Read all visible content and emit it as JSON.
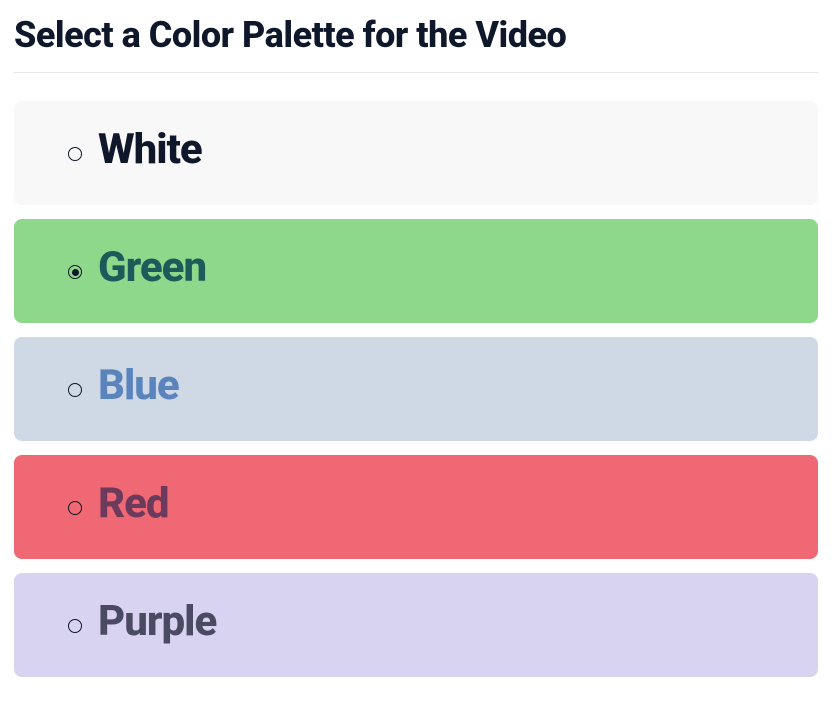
{
  "title": "Select a Color Palette for the Video",
  "options": [
    {
      "label": "White",
      "cls": "white",
      "checked": false
    },
    {
      "label": "Green",
      "cls": "green",
      "checked": true
    },
    {
      "label": "Blue",
      "cls": "blue",
      "checked": false
    },
    {
      "label": "Red",
      "cls": "red",
      "checked": false
    },
    {
      "label": "Purple",
      "cls": "purple",
      "checked": false
    }
  ]
}
